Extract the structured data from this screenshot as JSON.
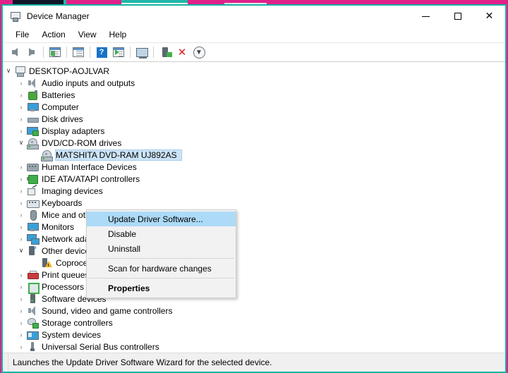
{
  "desktop": {
    "background_color": "#e0218a",
    "accent_color": "#17b3a3"
  },
  "window": {
    "title": "Device Manager",
    "title_icon": "device-manager-icon",
    "border_color": "#17b3a3",
    "controls": {
      "minimize": "–",
      "maximize": "☐",
      "close": "✕"
    }
  },
  "menubar": {
    "items": [
      {
        "label": "File",
        "name": "menu-file"
      },
      {
        "label": "Action",
        "name": "menu-action"
      },
      {
        "label": "View",
        "name": "menu-view"
      },
      {
        "label": "Help",
        "name": "menu-help"
      }
    ]
  },
  "toolbar": {
    "buttons": [
      {
        "name": "back-icon",
        "tooltip": "Back"
      },
      {
        "name": "forward-icon",
        "tooltip": "Forward"
      },
      {
        "name": "show-hide-console-tree-icon",
        "tooltip": "Show/Hide Console Tree"
      },
      {
        "name": "properties-icon",
        "tooltip": "Properties"
      },
      {
        "name": "help-icon",
        "tooltip": "Help"
      },
      {
        "name": "update-driver-icon",
        "tooltip": "Update Driver Software"
      },
      {
        "name": "scan-for-hardware-changes-icon",
        "tooltip": "Scan for hardware changes"
      },
      {
        "name": "enable-device-icon",
        "tooltip": "Enable device"
      },
      {
        "name": "uninstall-device-icon",
        "tooltip": "Uninstall device"
      },
      {
        "name": "disable-device-icon",
        "tooltip": "Disable device"
      }
    ]
  },
  "tree": {
    "root": {
      "label": "DESKTOP-AOJLVAR",
      "icon": "computer-icon",
      "expanded": true
    },
    "items": [
      {
        "label": "Audio inputs and outputs",
        "icon": "speaker-icon",
        "expanded": false,
        "level": 1
      },
      {
        "label": "Batteries",
        "icon": "battery-icon",
        "expanded": false,
        "level": 1
      },
      {
        "label": "Computer",
        "icon": "monitor-icon",
        "expanded": false,
        "level": 1
      },
      {
        "label": "Disk drives",
        "icon": "disk-drive-icon",
        "expanded": false,
        "level": 1
      },
      {
        "label": "Display adapters",
        "icon": "display-adapter-icon",
        "expanded": false,
        "level": 1
      },
      {
        "label": "DVD/CD-ROM drives",
        "icon": "dvd-drive-icon",
        "expanded": true,
        "level": 1
      },
      {
        "label": "MATSHITA DVD-RAM UJ892AS",
        "icon": "dvd-device-icon",
        "expanded": null,
        "level": 2,
        "selected": true
      },
      {
        "label": "Human Interface Devices",
        "icon": "hid-icon",
        "expanded": false,
        "level": 1
      },
      {
        "label": "IDE ATA/ATAPI controllers",
        "icon": "ide-controller-icon",
        "expanded": false,
        "level": 1
      },
      {
        "label": "Imaging devices",
        "icon": "imaging-device-icon",
        "expanded": false,
        "level": 1
      },
      {
        "label": "Keyboards",
        "icon": "keyboard-icon",
        "expanded": false,
        "level": 1
      },
      {
        "label": "Mice and other pointing devices",
        "icon": "mouse-icon",
        "expanded": false,
        "level": 1
      },
      {
        "label": "Monitors",
        "icon": "monitor-icon",
        "expanded": false,
        "level": 1
      },
      {
        "label": "Network adapters",
        "icon": "network-adapter-icon",
        "expanded": false,
        "level": 1
      },
      {
        "label": "Other devices",
        "icon": "other-device-icon",
        "expanded": true,
        "level": 1
      },
      {
        "label": "Coprocessor",
        "icon": "coprocessor-warning-icon",
        "expanded": null,
        "level": 2
      },
      {
        "label": "Print queues",
        "icon": "printer-icon",
        "expanded": false,
        "level": 1
      },
      {
        "label": "Processors",
        "icon": "processor-icon",
        "expanded": false,
        "level": 1
      },
      {
        "label": "Software devices",
        "icon": "software-device-icon",
        "expanded": false,
        "level": 1
      },
      {
        "label": "Sound, video and game controllers",
        "icon": "speaker-icon",
        "expanded": false,
        "level": 1
      },
      {
        "label": "Storage controllers",
        "icon": "storage-controller-icon",
        "expanded": false,
        "level": 1
      },
      {
        "label": "System devices",
        "icon": "system-device-icon",
        "expanded": false,
        "level": 1
      },
      {
        "label": "Universal Serial Bus controllers",
        "icon": "usb-controller-icon",
        "expanded": false,
        "level": 1
      }
    ],
    "collapsed_glyph": "›",
    "expanded_glyph": "∨",
    "selection_color": "#cce4f7"
  },
  "context_menu": {
    "highlight_color": "#addaf7",
    "items": [
      {
        "label": "Update Driver Software...",
        "name": "ctx-update-driver-software",
        "highlighted": true,
        "bold": false
      },
      {
        "label": "Disable",
        "name": "ctx-disable",
        "highlighted": false,
        "bold": false
      },
      {
        "label": "Uninstall",
        "name": "ctx-uninstall",
        "highlighted": false,
        "bold": false
      },
      {
        "separator": true
      },
      {
        "label": "Scan for hardware changes",
        "name": "ctx-scan-for-hardware-changes",
        "highlighted": false,
        "bold": false
      },
      {
        "separator": true
      },
      {
        "label": "Properties",
        "name": "ctx-properties",
        "highlighted": false,
        "bold": true
      }
    ]
  },
  "statusbar": {
    "text": "Launches the Update Driver Software Wizard for the selected device."
  }
}
